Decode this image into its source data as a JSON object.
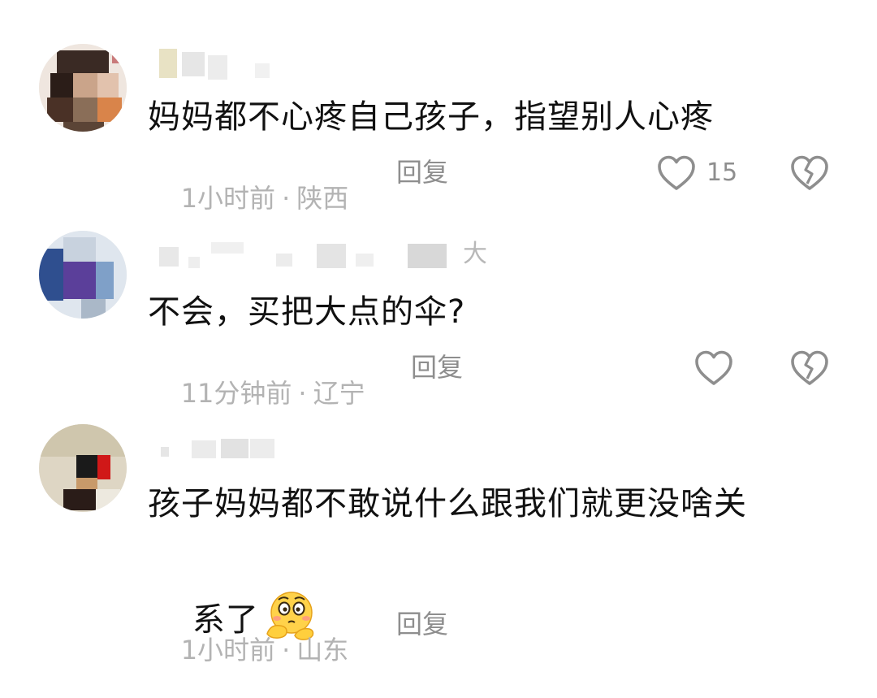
{
  "comments": [
    {
      "username_visible": "",
      "text": "妈妈都不心疼自己孩子，指望别人心疼",
      "time": "1小时前",
      "location": "陕西",
      "reply_label": "回复",
      "like_count": "15"
    },
    {
      "username_visible": "大",
      "text": "不会，买把大点的伞?",
      "time": "11分钟前",
      "location": "辽宁",
      "reply_label": "回复",
      "like_count": ""
    },
    {
      "username_visible": "",
      "text_line1": "孩子妈妈都不敢说什么跟我们就更没啥关",
      "text_line2": "系了",
      "emoji": "flushed-thinking-emoji",
      "time": "1小时前",
      "location": "山东",
      "reply_label": "回复"
    }
  ],
  "meta_separator": "·",
  "icons": {
    "like": "heart-outline-icon",
    "dislike": "broken-heart-icon"
  },
  "colors": {
    "text": "#111111",
    "meta": "#b3b3b3",
    "action": "#8e8e8e"
  }
}
